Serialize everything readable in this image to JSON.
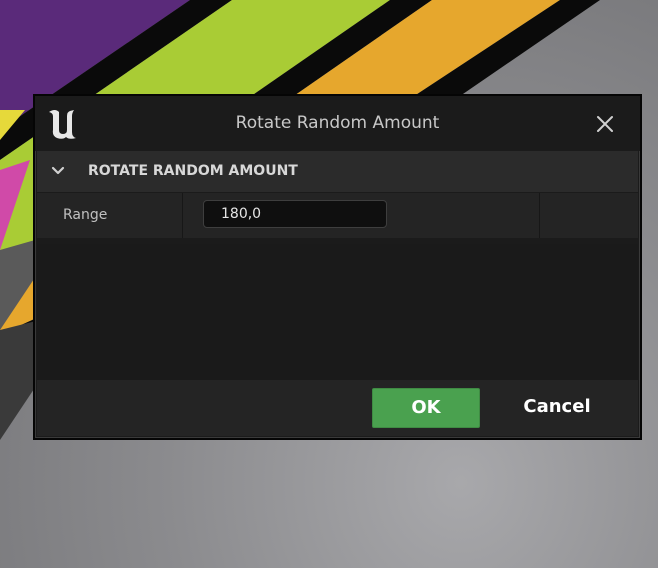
{
  "dialog": {
    "title": "Rotate Random Amount",
    "logo_icon": "unreal-engine-logo-icon",
    "close_icon": "close-icon"
  },
  "section": {
    "title": "ROTATE RANDOM AMOUNT",
    "expand_icon": "chevron-down-icon"
  },
  "properties": [
    {
      "label": "Range",
      "value": "180,0"
    }
  ],
  "footer": {
    "ok_label": "OK",
    "cancel_label": "Cancel"
  },
  "colors": {
    "ok_button": "#4aa14f",
    "dialog_bg": "#1b1b1b",
    "section_bg": "#2b2b2b"
  }
}
